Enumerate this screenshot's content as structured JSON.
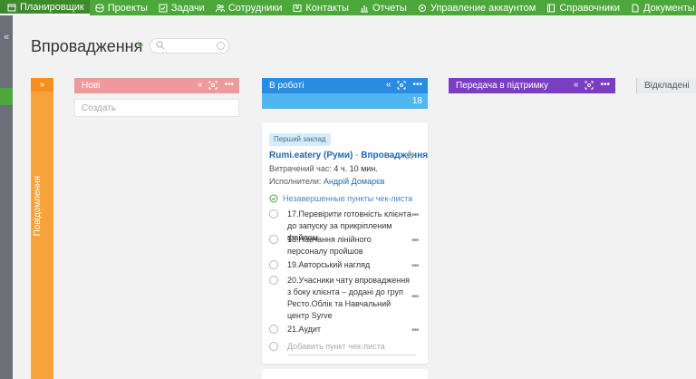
{
  "topnav": {
    "items": [
      {
        "label": "Планировщик",
        "icon": "calendar-icon"
      },
      {
        "label": "Проекты",
        "icon": "stack-icon"
      },
      {
        "label": "Задачи",
        "icon": "checkbox-icon"
      },
      {
        "label": "Сотрудники",
        "icon": "people-icon"
      },
      {
        "label": "Контакты",
        "icon": "contact-card-icon"
      },
      {
        "label": "Отчеты",
        "icon": "chart-icon"
      },
      {
        "label": "Управление аккаунтом",
        "icon": "settings-icon"
      },
      {
        "label": "Справочники",
        "icon": "book-icon"
      },
      {
        "label": "Документы",
        "icon": "document-icon"
      }
    ]
  },
  "page": {
    "title": "Впровадження",
    "search_placeholder": ""
  },
  "sidebar": {
    "collapse_glyph": "«",
    "vertical_column": {
      "label": "Повідомлення",
      "expand_glyph": "»"
    }
  },
  "columns": {
    "new": {
      "title": "Нові",
      "create_placeholder": "Создать",
      "color": "#ee9a9c"
    },
    "in_work": {
      "title": "В роботі",
      "count": "18",
      "color": "#2a8be0"
    },
    "support": {
      "title": "Передача в підтримку",
      "color": "#7b3ec3"
    },
    "deferred": {
      "title": "Відкладені"
    }
  },
  "card": {
    "tag": "Перший заклад",
    "title": "Rumi.eatery (Руми)",
    "title_sep": "-",
    "title_stage": "Впровадження",
    "time_label": "Витрачений час:",
    "time_value": "4 ч. 10 мин.",
    "assignee_label": "Исполнители:",
    "assignee": "Андрій Домарєв",
    "checklist_header": "Незавершенные пункты чек-листа",
    "checklist": [
      "17.Перевірити готовність клієнта до запуску за прикріпленим файлом",
      "18.Навчання лінійного персоналу пройшов",
      "19.Авторський нагляд",
      "20.Учасники чату впровадження з боку клієнта – додані до груп Ресто.Облік та Навчальний центр Syrve",
      "21.Аудит"
    ],
    "add_checklist_placeholder": "Добавить пункт чек-листа"
  },
  "colors": {
    "brand_green": "#4da83b",
    "orange": "#f7a23a"
  }
}
